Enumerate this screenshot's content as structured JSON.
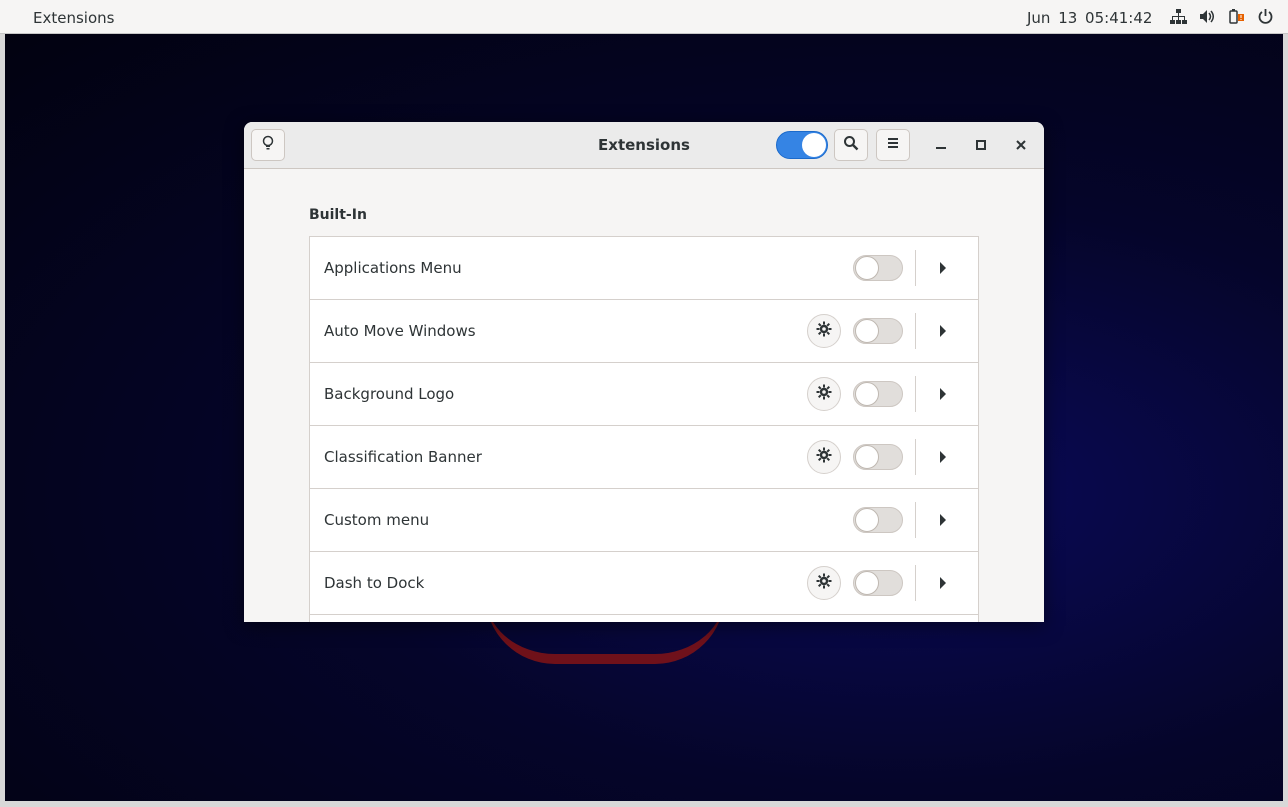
{
  "top_bar": {
    "activities_label": "Extensions",
    "clock": "Jun 13  05:41:42",
    "tray_icons": [
      "network-icon",
      "volume-icon",
      "battery-icon",
      "power-icon"
    ]
  },
  "window": {
    "title": "Extensions",
    "master_switch_on": true,
    "section_title": "Built-In",
    "extensions": [
      {
        "name": "Applications Menu",
        "has_settings": false,
        "enabled": false
      },
      {
        "name": "Auto Move Windows",
        "has_settings": true,
        "enabled": false
      },
      {
        "name": "Background Logo",
        "has_settings": true,
        "enabled": false
      },
      {
        "name": "Classification Banner",
        "has_settings": true,
        "enabled": false
      },
      {
        "name": "Custom menu",
        "has_settings": false,
        "enabled": false
      },
      {
        "name": "Dash to Dock",
        "has_settings": true,
        "enabled": false
      }
    ]
  },
  "colors": {
    "accent": "#3584e4",
    "panel_bg": "#f6f5f4",
    "desktop_bg": "#05052a"
  }
}
